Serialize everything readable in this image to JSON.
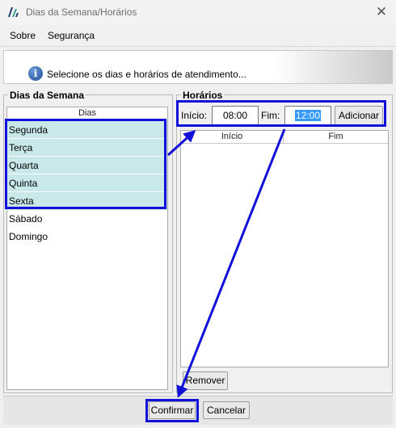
{
  "window": {
    "title": "Dias da Semana/Horários",
    "close_glyph": "✕",
    "logo_icon": "app-logo-icon"
  },
  "menu": {
    "items": [
      {
        "label": "Sobre"
      },
      {
        "label": "Segurança"
      }
    ]
  },
  "banner": {
    "icon": "info-icon",
    "icon_glyph": "i",
    "text": "Selecione os dias e horários de atendimento..."
  },
  "days_panel": {
    "title": "Dias da Semana",
    "column_header": "Dias",
    "rows": [
      {
        "label": "Segunda",
        "selected": true
      },
      {
        "label": "Terça",
        "selected": true
      },
      {
        "label": "Quarta",
        "selected": true
      },
      {
        "label": "Quinta",
        "selected": true
      },
      {
        "label": "Sexta",
        "selected": true
      },
      {
        "label": "Sábado",
        "selected": false
      },
      {
        "label": "Domingo",
        "selected": false
      }
    ],
    "selection_color": "#c8e8ea"
  },
  "hours_panel": {
    "title": "Horários",
    "inicio_label": "Início:",
    "inicio_value": "08:00",
    "fim_label": "Fim:",
    "fim_value": "12:00",
    "add_button": "Adicionar",
    "columns": [
      "Início",
      "Fim"
    ],
    "remove_button": "Remover"
  },
  "footer": {
    "confirm_button": "Confirmar",
    "cancel_button": "Cancelar"
  },
  "annotation_color": "#1010d8"
}
